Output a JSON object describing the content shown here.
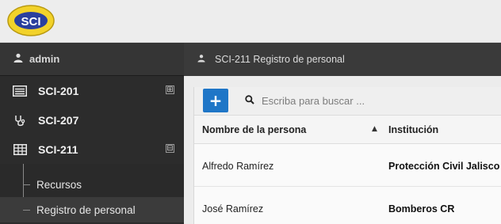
{
  "header": {
    "logo_text": "SCI"
  },
  "sidebar": {
    "user": "admin",
    "items": [
      {
        "label": "SCI-201",
        "icon": "list-icon",
        "toggle": "⊞"
      },
      {
        "label": "SCI-207",
        "icon": "stethoscope-icon"
      },
      {
        "label": "SCI-211",
        "icon": "table-icon",
        "toggle": "⊟"
      }
    ],
    "subitems": [
      {
        "label": "Recursos"
      },
      {
        "label": "Registro de personal",
        "active": true
      }
    ]
  },
  "main": {
    "breadcrumb": "SCI-211 Registro de personal",
    "toolbar": {
      "add_label": "+",
      "search_placeholder": "Escriba para buscar ..."
    },
    "table": {
      "columns": [
        "Nombre de la persona",
        "Institución"
      ],
      "sort_indicator": "▲",
      "rows": [
        {
          "nombre": "Alfredo Ramírez",
          "institucion": "Protección Civil Jalisco"
        },
        {
          "nombre": "José Ramírez",
          "institucion": "Bomberos CR"
        }
      ]
    }
  },
  "colors": {
    "accent": "#1f76c7",
    "sidebar_bg": "#2c2c2c",
    "logo_yellow": "#f2d22a",
    "logo_blue": "#2a3f9e"
  }
}
